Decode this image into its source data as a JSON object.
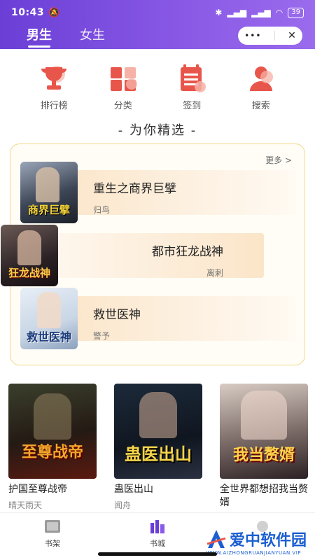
{
  "status": {
    "time": "10:43",
    "battery": "39"
  },
  "tabs": [
    {
      "label": "男生",
      "active": true
    },
    {
      "label": "女生",
      "active": false
    }
  ],
  "capsule": {
    "more_icon": "•••",
    "close_icon": "✕"
  },
  "nav": [
    {
      "label": "排行榜",
      "icon": "trophy-icon"
    },
    {
      "label": "分类",
      "icon": "grid-icon"
    },
    {
      "label": "签到",
      "icon": "checkin-calendar-icon"
    },
    {
      "label": "搜索",
      "icon": "person-search-icon"
    }
  ],
  "section_title": "- 为你精选 -",
  "more_label": "更多 >",
  "featured": [
    {
      "title": "重生之商界巨擘",
      "author": "归鸟",
      "cover_text": "商界巨擘"
    },
    {
      "title": "都市狂龙战神",
      "author": "离剌",
      "cover_text": "狂龙战神"
    },
    {
      "title": "救世医神",
      "author": "警予",
      "cover_text": "救世医神"
    }
  ],
  "grid": [
    {
      "title": "护国至尊战帝",
      "author": "晴天雨天",
      "cover_text": "至尊战帝"
    },
    {
      "title": "蛊医出山",
      "author": "闻舟",
      "cover_text": "蛊医出山"
    },
    {
      "title": "全世界都想招我当赘婿",
      "author": "",
      "cover_text": "我当赘婿"
    }
  ],
  "tabbar": [
    {
      "label": "书架",
      "icon": "bookshelf-icon"
    },
    {
      "label": "书城",
      "icon": "bookstore-icon"
    },
    {
      "label": "",
      "icon": "profile-icon"
    }
  ],
  "watermark": {
    "text": "爱中软件园",
    "sub": "WWW.AIZHONGRUANJIANYUAN.VIP"
  },
  "colors": {
    "header": "#7a4be0",
    "accent": "#e8554a",
    "featured_border": "#f0d98a"
  }
}
